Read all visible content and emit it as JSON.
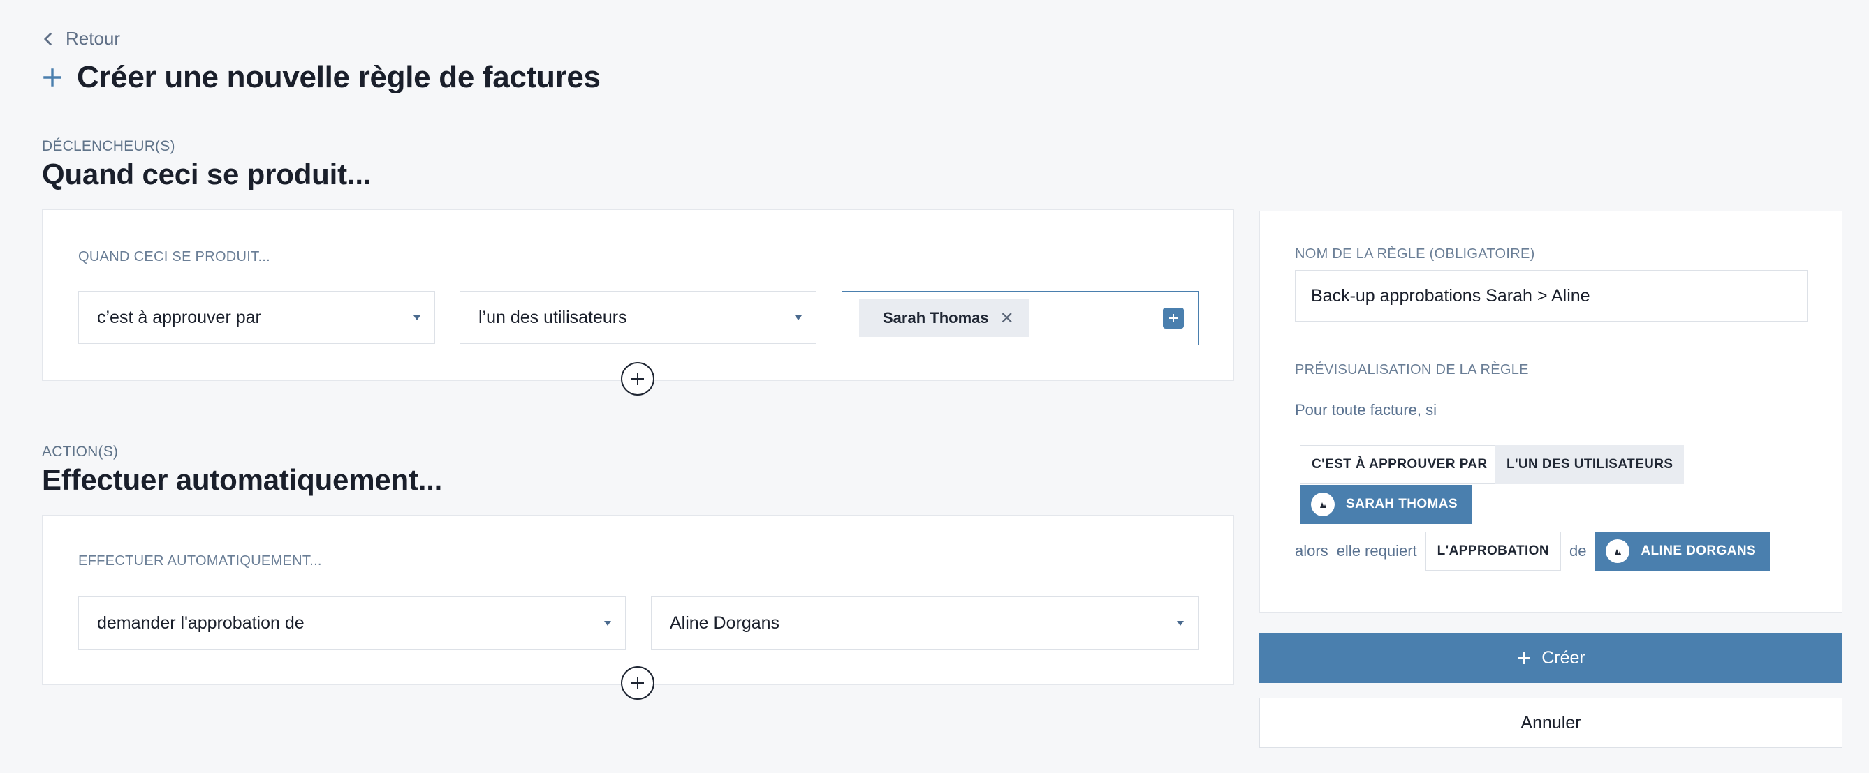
{
  "nav": {
    "back_label": "Retour"
  },
  "page": {
    "title": "Créer une nouvelle règle de factures"
  },
  "triggers": {
    "eyebrow": "DÉCLENCHEUR(S)",
    "title": "Quand ceci se produit...",
    "card_label": "QUAND CECI SE PRODUIT...",
    "condition_select": "c’est à approuver par",
    "scope_select": "l’un des utilisateurs",
    "selected_users": [
      "Sarah Thomas"
    ]
  },
  "actions": {
    "eyebrow": "ACTION(S)",
    "title": "Effectuer automatiquement...",
    "card_label": "EFFECTUER AUTOMATIQUEMENT...",
    "action_select": "demander l'approbation de",
    "approver_select": "Aline Dorgans"
  },
  "rule": {
    "name_label": "NOM DE LA RÈGLE (OBLIGATOIRE)",
    "name_value": "Back-up approbations Sarah > Aline",
    "preview_label": "PRÉVISUALISATION DE LA RÈGLE",
    "preview_lead": "Pour toute facture, si",
    "preview_tags": {
      "condition": "C'EST À APPROUVER PAR",
      "scope": "L'UN DES UTILISATEURS",
      "user": "SARAH THOMAS",
      "word_then": "alors",
      "word_requires": "elle requiert",
      "action": "L'APPROBATION",
      "word_of": "de",
      "approver": "ALINE DORGANS"
    }
  },
  "buttons": {
    "create": "Créer",
    "cancel": "Annuler"
  },
  "colors": {
    "accent": "#4a7fae",
    "background": "#f6f7f9",
    "label": "#6a7e96"
  }
}
